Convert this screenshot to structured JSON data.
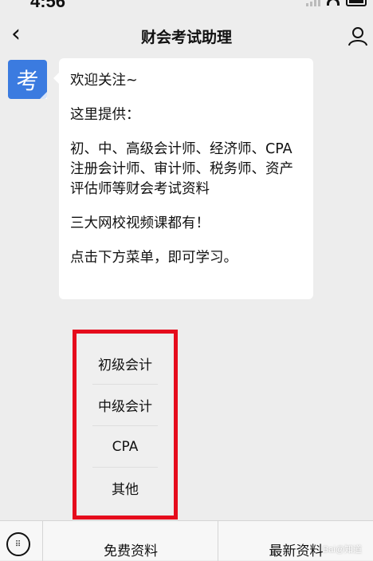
{
  "status": {
    "time": "4:56"
  },
  "nav": {
    "back_icon": "‹",
    "title": "财会考试助理"
  },
  "avatar": {
    "char": "考",
    "color": "#3b7be0"
  },
  "message": {
    "paragraphs": [
      "欢迎关注~",
      "这里提供：",
      "初、中、高级会计师、经济师、CPA注册会计师、审计师、税务师、资产评估师等财会考试资料",
      "三大网校视频课都有！",
      "点击下方菜单，即可学习。"
    ]
  },
  "menu": {
    "items": [
      "初级会计",
      "中级会计",
      "CPA",
      "其他"
    ],
    "highlight_color": "#e50b1c"
  },
  "bottom": {
    "tab1": "免费资料",
    "tab2": "最新资料"
  },
  "watermark": "Bai@知道"
}
